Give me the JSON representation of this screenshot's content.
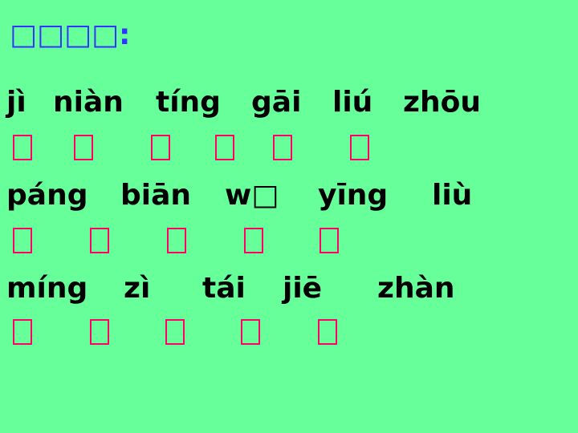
{
  "title": "□□□□:",
  "rows": [
    {
      "pinyin": [
        "jì",
        "niàn",
        "tíng",
        "gāi",
        "liú",
        "zhōu"
      ],
      "boxes": 6
    },
    {
      "pinyin": [
        "páng",
        "biān",
        "w□",
        "yīng",
        "liù"
      ],
      "boxes": 5
    },
    {
      "pinyin": [
        "míng",
        "zì",
        "tái",
        "jiē",
        "zhàn"
      ],
      "boxes": 5
    }
  ],
  "colors": {
    "background": "#66ff99",
    "title": "#3333ff",
    "pinyin": "#000000",
    "box_border": "#ff0066"
  }
}
